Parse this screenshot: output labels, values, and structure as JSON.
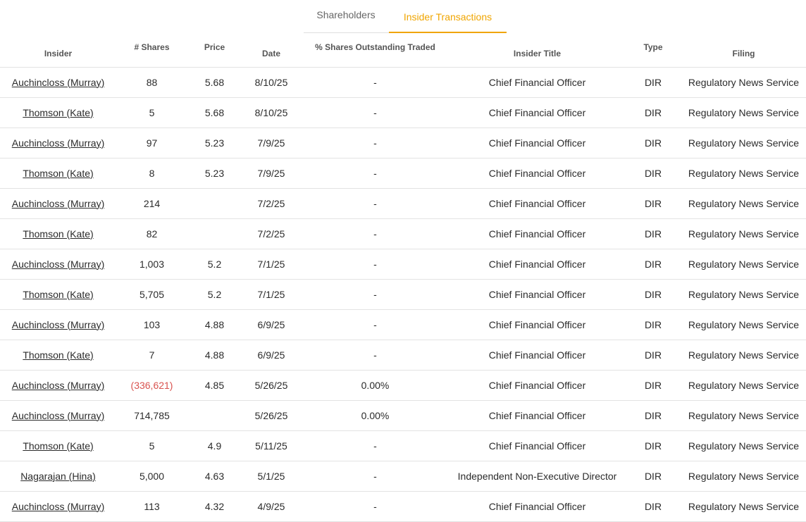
{
  "tabs": [
    {
      "label": "Shareholders",
      "active": false
    },
    {
      "label": "Insider Transactions",
      "active": true
    }
  ],
  "colors": {
    "accent": "#f0a500",
    "negative": "#d9534f"
  },
  "table": {
    "headers": [
      "Insider",
      "# Shares",
      "Price",
      "Date",
      "% Shares Outstanding Traded",
      "Insider Title",
      "Type",
      "Filing"
    ],
    "rows": [
      [
        "Auchincloss (Murray)",
        "88",
        "5.68",
        "8/10/25",
        "-",
        "Chief Financial Officer",
        "DIR",
        "Regulatory News Service"
      ],
      [
        "Thomson (Kate)",
        "5",
        "5.68",
        "8/10/25",
        "-",
        "Chief Financial Officer",
        "DIR",
        "Regulatory News Service"
      ],
      [
        "Auchincloss (Murray)",
        "97",
        "5.23",
        "7/9/25",
        "-",
        "Chief Financial Officer",
        "DIR",
        "Regulatory News Service"
      ],
      [
        "Thomson (Kate)",
        "8",
        "5.23",
        "7/9/25",
        "-",
        "Chief Financial Officer",
        "DIR",
        "Regulatory News Service"
      ],
      [
        "Auchincloss (Murray)",
        "214",
        "",
        "7/2/25",
        "-",
        "Chief Financial Officer",
        "DIR",
        "Regulatory News Service"
      ],
      [
        "Thomson (Kate)",
        "82",
        "",
        "7/2/25",
        "-",
        "Chief Financial Officer",
        "DIR",
        "Regulatory News Service"
      ],
      [
        "Auchincloss (Murray)",
        "1,003",
        "5.2",
        "7/1/25",
        "-",
        "Chief Financial Officer",
        "DIR",
        "Regulatory News Service"
      ],
      [
        "Thomson (Kate)",
        "5,705",
        "5.2",
        "7/1/25",
        "-",
        "Chief Financial Officer",
        "DIR",
        "Regulatory News Service"
      ],
      [
        "Auchincloss (Murray)",
        "103",
        "4.88",
        "6/9/25",
        "-",
        "Chief Financial Officer",
        "DIR",
        "Regulatory News Service"
      ],
      [
        "Thomson (Kate)",
        "7",
        "4.88",
        "6/9/25",
        "-",
        "Chief Financial Officer",
        "DIR",
        "Regulatory News Service"
      ],
      [
        "Auchincloss (Murray)",
        "(336,621)",
        "4.85",
        "5/26/25",
        "0.00%",
        "Chief Financial Officer",
        "DIR",
        "Regulatory News Service"
      ],
      [
        "Auchincloss (Murray)",
        "714,785",
        "",
        "5/26/25",
        "0.00%",
        "Chief Financial Officer",
        "DIR",
        "Regulatory News Service"
      ],
      [
        "Thomson (Kate)",
        "5",
        "4.9",
        "5/11/25",
        "-",
        "Chief Financial Officer",
        "DIR",
        "Regulatory News Service"
      ],
      [
        "Nagarajan (Hina)",
        "5,000",
        "4.63",
        "5/1/25",
        "-",
        "Independent Non-Executive Director",
        "DIR",
        "Regulatory News Service"
      ],
      [
        "Auchincloss (Murray)",
        "113",
        "4.32",
        "4/9/25",
        "-",
        "Chief Financial Officer",
        "DIR",
        "Regulatory News Service"
      ]
    ]
  }
}
